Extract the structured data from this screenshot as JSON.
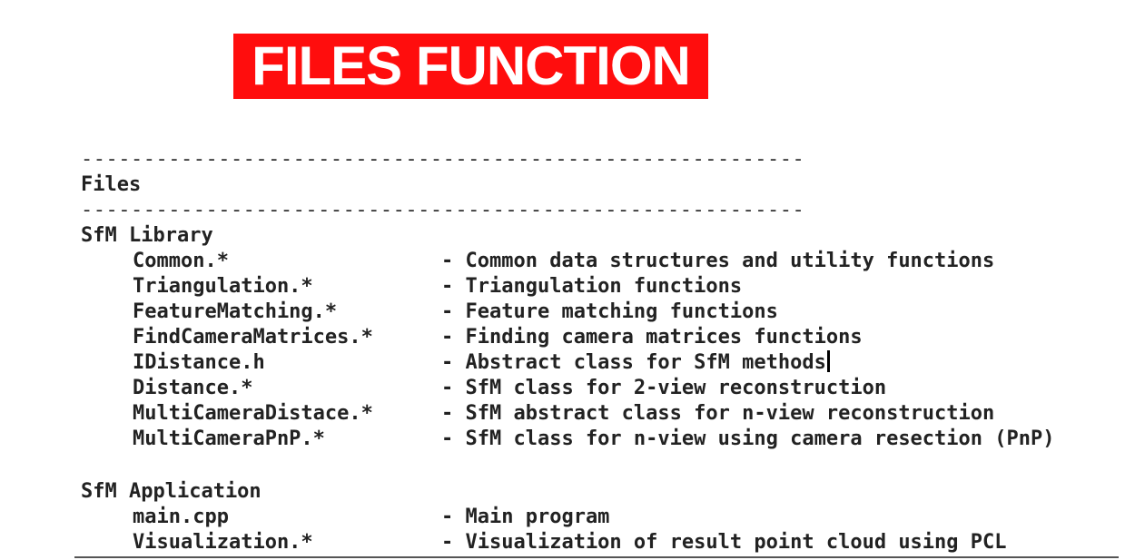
{
  "title": "FILES FUNCTION",
  "divider": "----------------------------------------------------------",
  "section_header": "Files",
  "library": {
    "heading": "SfM Library",
    "rows": [
      {
        "name": "Common.*",
        "desc": "- Common data structures and utility functions"
      },
      {
        "name": "Triangulation.*",
        "desc": "- Triangulation functions"
      },
      {
        "name": "FeatureMatching.*",
        "desc": "- Feature matching functions"
      },
      {
        "name": "FindCameraMatrices.*",
        "desc": "- Finding camera matrices functions"
      },
      {
        "name": "IDistance.h",
        "desc": "- Abstract class for SfM methods"
      },
      {
        "name": "Distance.*",
        "desc": "- SfM class for 2-view reconstruction"
      },
      {
        "name": "MultiCameraDistace.*",
        "desc": "- SfM abstract class for n-view reconstruction"
      },
      {
        "name": "MultiCameraPnP.*",
        "desc": "- SfM class for n-view using camera resection (PnP)"
      }
    ]
  },
  "application": {
    "heading": "SfM Application",
    "rows": [
      {
        "name": "main.cpp",
        "desc": "- Main program"
      },
      {
        "name": "Visualization.*",
        "desc": "- Visualization of result point cloud using PCL"
      }
    ]
  }
}
